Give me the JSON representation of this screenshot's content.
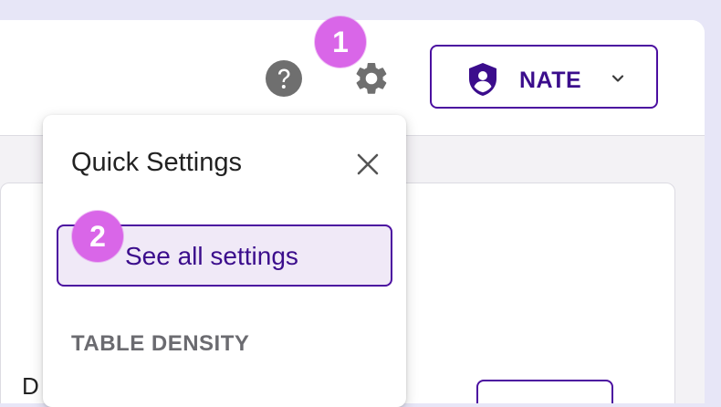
{
  "header": {
    "help_icon": "help-circle-icon",
    "settings_icon": "gear-icon",
    "user": {
      "name": "NATE",
      "avatar_icon": "user-shield-icon",
      "dropdown_icon": "chevron-down-icon"
    }
  },
  "quick_settings": {
    "title": "Quick Settings",
    "close_icon": "close-icon",
    "see_all_label": "See all settings",
    "section_heading": "TABLE DENSITY"
  },
  "background": {
    "partial_text": "D"
  },
  "annotations": {
    "badge_1": "1",
    "badge_2": "2"
  },
  "colors": {
    "accent": "#4b0fa0",
    "accent_text": "#3b0d8c",
    "badge": "#d966e8",
    "highlight_bg": "#f0e9f7",
    "icon_gray": "#6f6f6f",
    "page_bg": "#e7e6f7"
  }
}
